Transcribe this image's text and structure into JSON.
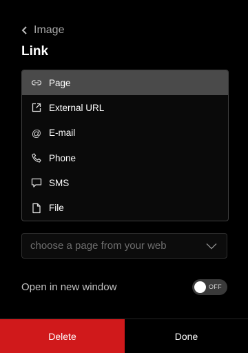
{
  "header": {
    "back_label": "Image",
    "title": "Link"
  },
  "link_types": [
    {
      "label": "Page",
      "icon": "link-icon",
      "selected": true
    },
    {
      "label": "External URL",
      "icon": "external-link-icon",
      "selected": false
    },
    {
      "label": "E-mail",
      "icon": "at-sign-icon",
      "selected": false
    },
    {
      "label": "Phone",
      "icon": "phone-icon",
      "selected": false
    },
    {
      "label": "SMS",
      "icon": "message-icon",
      "selected": false
    },
    {
      "label": "File",
      "icon": "file-icon",
      "selected": false
    }
  ],
  "page_select": {
    "placeholder": "choose a page from your web"
  },
  "new_window": {
    "label": "Open in new window",
    "toggle_state": "OFF",
    "enabled": false
  },
  "footer": {
    "delete_label": "Delete",
    "done_label": "Done"
  },
  "colors": {
    "background": "#000000",
    "delete": "#d0191b",
    "selected_item": "#4a4a4a"
  }
}
